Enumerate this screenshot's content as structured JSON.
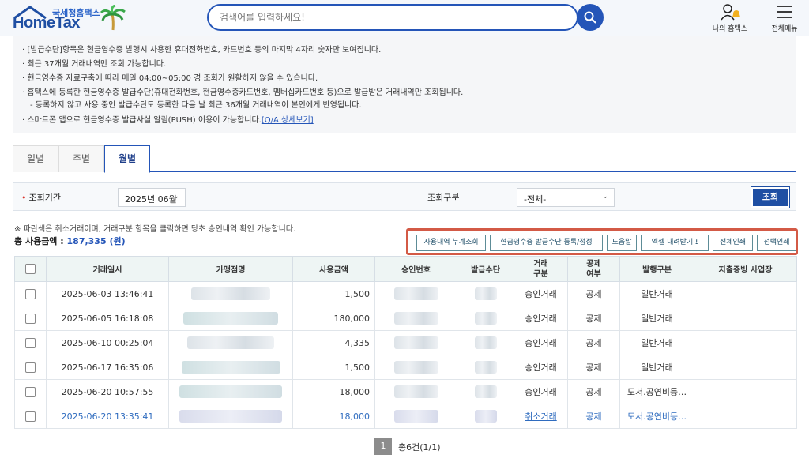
{
  "header": {
    "logo_small": "국세청홈택스",
    "logo_main": "HomeTax",
    "search_placeholder": "검색어를 입력하세요!",
    "my_hometax": "나의 홈택스",
    "all_menu": "전체메뉴"
  },
  "notice": [
    {
      "text": "· [발급수단]항목은 현금영수증 발행시 사용한 휴대전화번호, 카드번호 등의 마지막 4자리 숫자만 보여집니다.",
      "sub": false
    },
    {
      "text": "· 최근 37개월 거래내역만 조회 가능합니다.",
      "sub": false
    },
    {
      "text": "· 현금영수증 자료구축에 따라 매일 04:00~05:00 경 조회가 원활하지 않을 수 있습니다.",
      "sub": false
    },
    {
      "text": "· 홈택스에 등록한 현금영수증 발급수단(휴대전화번호, 현금영수증카드번호, 멤버십카드번호 등)으로 발급받은 거래내역만 조회됩니다.",
      "sub": false
    },
    {
      "text": "- 등록하지 않고 사용 중인 발급수단도 등록한 다음 날 최근 36개월 거래내역이 본인에게 반영됩니다.",
      "sub": true
    },
    {
      "text": "· 스마트폰 앱으로 현금영수증 발급사실 알림(PUSH) 이용이 가능합니다.",
      "sub": false
    }
  ],
  "notice_link": "[Q/A 상세보기]",
  "tabs": [
    "일별",
    "주별",
    "월별"
  ],
  "filter": {
    "period_label": "조회기간",
    "period_value": "2025년 06월",
    "type_label": "조회구분",
    "type_value": "-전체-",
    "submit": "조회"
  },
  "note": "※ 파란색은 취소거래이며, 거래구분 항목을 클릭하면 당초 승인내역 확인 가능합니다.",
  "total_label": "총 사용금액 :",
  "total_value": "187,335 (원)",
  "actions": [
    "사용내역 누계조회",
    "현금영수증 발급수단 등록/정정",
    "도움말",
    "엑셀 내려받기",
    "전체인쇄",
    "선택인쇄"
  ],
  "table": {
    "headers": [
      "거래일시",
      "가맹점명",
      "사용금액",
      "승인번호",
      "발급수단",
      "거래\n구분",
      "공제\n여부",
      "발행구분",
      "지출증빙 사업장"
    ],
    "rows": [
      {
        "date": "2025-06-03 13:46:41",
        "amount": "1,500",
        "type": "승인거래",
        "deduct": "공제",
        "issue": "일반거래",
        "cancel": false
      },
      {
        "date": "2025-06-05 16:18:08",
        "amount": "180,000",
        "type": "승인거래",
        "deduct": "공제",
        "issue": "일반거래",
        "cancel": false
      },
      {
        "date": "2025-06-10 00:25:04",
        "amount": "4,335",
        "type": "승인거래",
        "deduct": "공제",
        "issue": "일반거래",
        "cancel": false
      },
      {
        "date": "2025-06-17 16:35:06",
        "amount": "1,500",
        "type": "승인거래",
        "deduct": "공제",
        "issue": "일반거래",
        "cancel": false
      },
      {
        "date": "2025-06-20 10:57:55",
        "amount": "18,000",
        "type": "승인거래",
        "deduct": "공제",
        "issue": "도서.공연비등…",
        "cancel": false
      },
      {
        "date": "2025-06-20 13:35:41",
        "amount": "18,000",
        "type": "취소거래",
        "deduct": "공제",
        "issue": "도서.공연비등…",
        "cancel": true
      }
    ]
  },
  "pager": {
    "page": "1",
    "total": "총6건(1/1)"
  },
  "colors": {
    "brand": "#2455b8",
    "accent_highlight": "#d35a46",
    "cancel_text": "#2f6cbf"
  }
}
